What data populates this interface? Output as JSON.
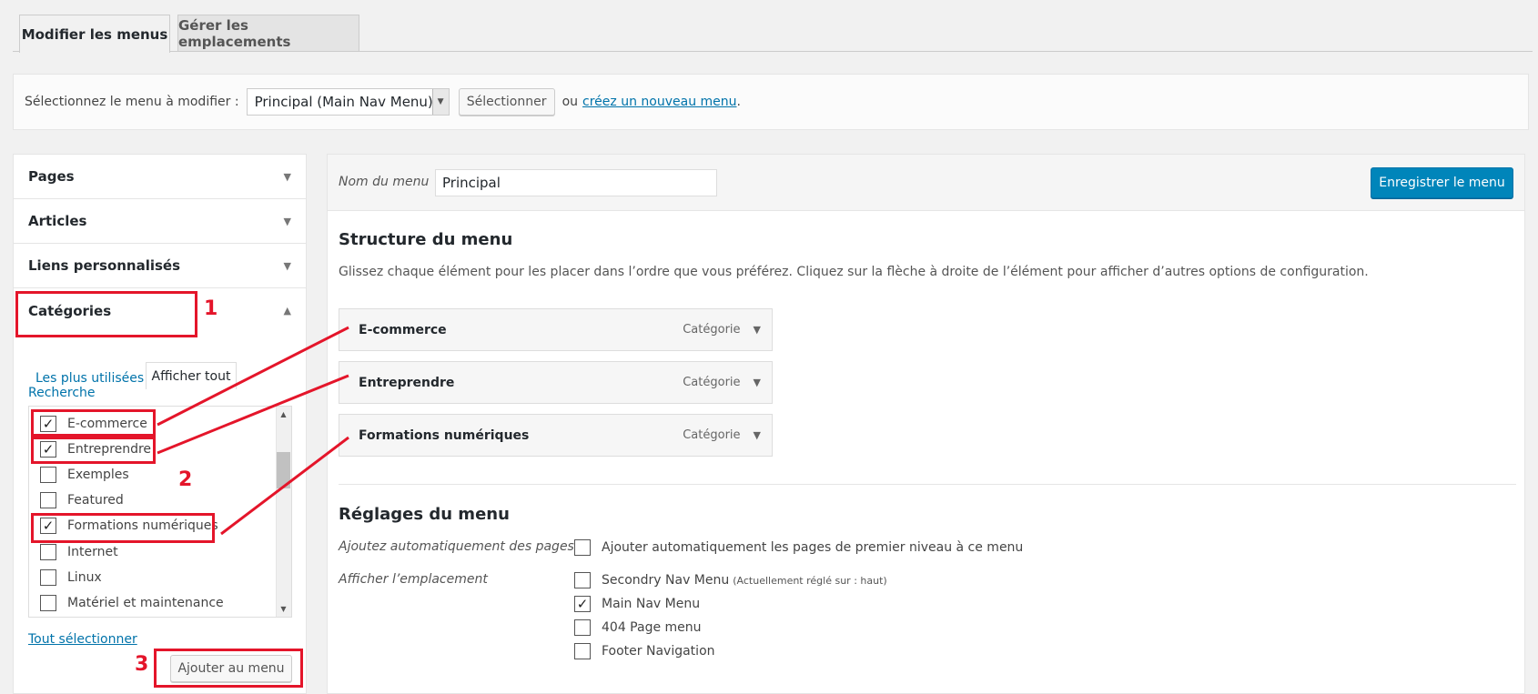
{
  "tabs": [
    {
      "label": "Modifier les menus",
      "active": true
    },
    {
      "label": "Gérer les emplacements",
      "active": false
    }
  ],
  "select_bar": {
    "label": "Sélectionnez le menu à modifier :",
    "selected_menu": "Principal (Main Nav Menu)",
    "select_button": "Sélectionner",
    "or_text": "ou",
    "create_link": "créez un nouveau menu",
    "period": "."
  },
  "left": {
    "sections": [
      {
        "label": "Pages",
        "expanded": false
      },
      {
        "label": "Articles",
        "expanded": false
      },
      {
        "label": "Liens personnalisés",
        "expanded": false
      },
      {
        "label": "Catégories",
        "expanded": true
      }
    ],
    "cat_tabs": {
      "most_used": "Les plus utilisées",
      "show_all": "Afficher tout",
      "search": "Recherche"
    },
    "categories": [
      {
        "label": "E-commerce",
        "checked": true
      },
      {
        "label": "Entreprendre",
        "checked": true
      },
      {
        "label": "Exemples",
        "checked": false
      },
      {
        "label": "Featured",
        "checked": false
      },
      {
        "label": "Formations numériques",
        "checked": true
      },
      {
        "label": "Internet",
        "checked": false
      },
      {
        "label": "Linux",
        "checked": false
      },
      {
        "label": "Matériel et maintenance",
        "checked": false
      }
    ],
    "select_all": "Tout sélectionner",
    "add_button": "Ajouter au menu"
  },
  "right": {
    "menu_name_label": "Nom du menu",
    "menu_name_value": "Principal",
    "save_button": "Enregistrer le menu",
    "structure_title": "Structure du menu",
    "structure_desc": "Glissez chaque élément pour les placer dans l’ordre que vous préférez. Cliquez sur la flèche à droite de l’élément pour afficher d’autres options de configuration.",
    "menu_items": [
      {
        "title": "E-commerce",
        "type": "Catégorie"
      },
      {
        "title": "Entreprendre",
        "type": "Catégorie"
      },
      {
        "title": "Formations numériques",
        "type": "Catégorie"
      }
    ],
    "settings_title": "Réglages du menu",
    "auto_add_label": "Ajoutez automatiquement des pages",
    "auto_add_option": {
      "label": "Ajouter automatiquement les pages de premier niveau à ce menu",
      "checked": false
    },
    "location_label": "Afficher l’emplacement",
    "locations": [
      {
        "label": "Secondry Nav Menu",
        "note": "(Actuellement réglé sur : haut)",
        "checked": false
      },
      {
        "label": "Main Nav Menu",
        "note": "",
        "checked": true
      },
      {
        "label": "404 Page menu",
        "note": "",
        "checked": false
      },
      {
        "label": "Footer Navigation",
        "note": "",
        "checked": false
      }
    ]
  },
  "annotations": {
    "step1": "1",
    "step2": "2",
    "step3": "3",
    "color": "#e4152a"
  },
  "colors": {
    "primary": "#0085ba",
    "link": "#0073aa",
    "annotation": "#e4152a"
  }
}
